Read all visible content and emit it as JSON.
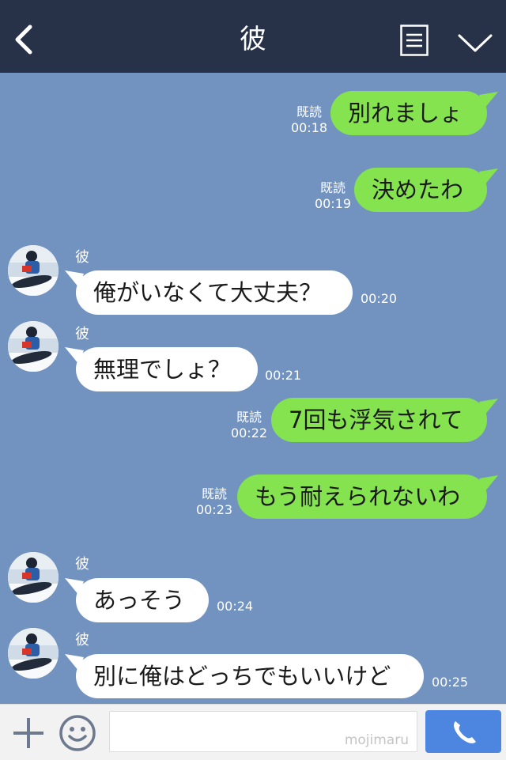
{
  "header": {
    "title": "彼",
    "back_icon": "back-chevron-icon",
    "menu_icon": "menu-icon",
    "expand_icon": "chevron-down-icon"
  },
  "messages": [
    {
      "dir": "out",
      "text": "別れましょ",
      "read": "既読",
      "time": "00:18"
    },
    {
      "dir": "out",
      "text": "決めたわ",
      "read": "既読",
      "time": "00:19"
    },
    {
      "dir": "in",
      "sender": "彼",
      "text": "俺がいなくて大丈夫？",
      "time": "00:20"
    },
    {
      "dir": "in",
      "sender": "彼",
      "text": "無理でしょ？",
      "time": "00:21"
    },
    {
      "dir": "out",
      "text": "7回も浮気されて",
      "read": "既読",
      "time": "00:22"
    },
    {
      "dir": "out",
      "text": "もう耐えられないわ",
      "read": "既読",
      "time": "00:23"
    },
    {
      "dir": "in",
      "sender": "彼",
      "text": "あっそう",
      "time": "00:24"
    },
    {
      "dir": "in",
      "sender": "彼",
      "text": "別に俺はどっちでもいいけど",
      "time": "00:25"
    }
  ],
  "footer": {
    "plus_icon": "plus-icon",
    "emoji_icon": "smiley-icon",
    "input_placeholder": "",
    "watermark": "mojimaru",
    "send_icon": "phone-icon"
  },
  "colors": {
    "header_bg": "#273248",
    "chat_bg": "#7293c0",
    "outgoing_bubble": "#84e34e",
    "incoming_bubble": "#ffffff",
    "send_button": "#4d86e0"
  }
}
